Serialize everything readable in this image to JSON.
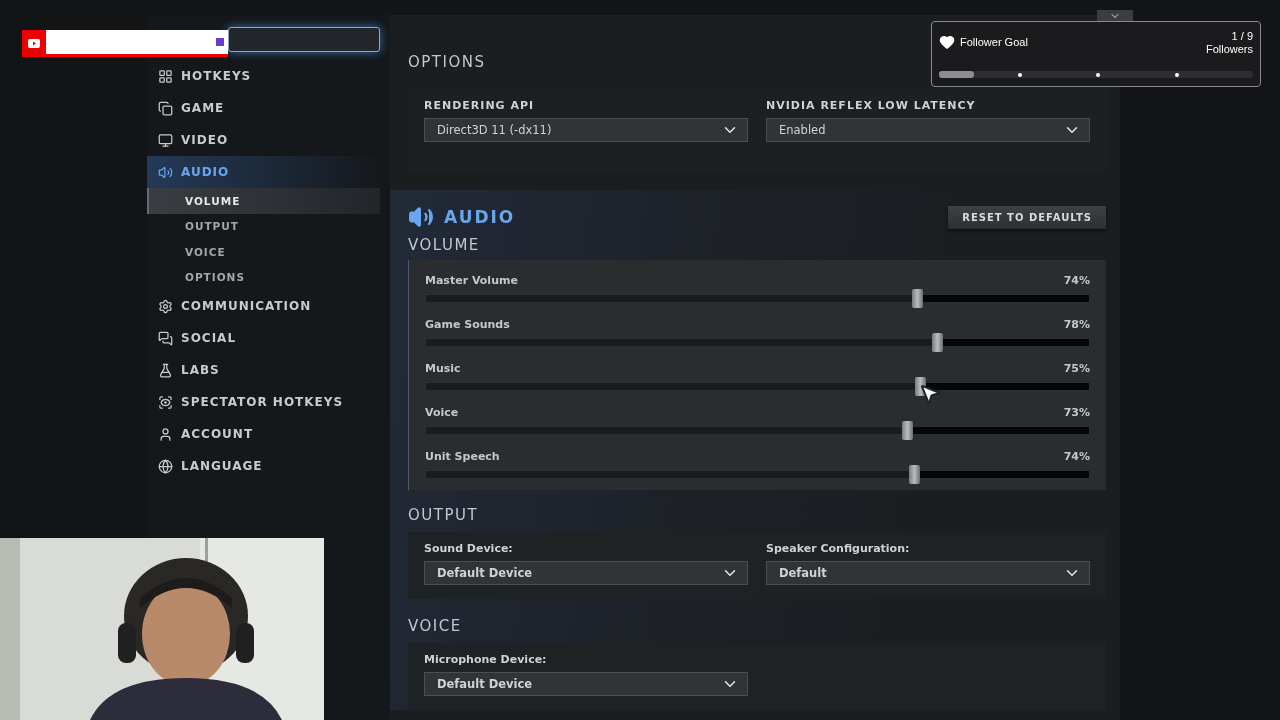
{
  "sidebar": {
    "search": {
      "kind": "field"
    },
    "items": [
      {
        "label": "HOTKEYS",
        "selected": false
      },
      {
        "label": "GAME",
        "selected": false
      },
      {
        "label": "VIDEO",
        "selected": false
      },
      {
        "label": "AUDIO",
        "selected": true,
        "children": [
          {
            "label": "VOLUME",
            "selected": true
          },
          {
            "label": "OUTPUT",
            "selected": false
          },
          {
            "label": "VOICE",
            "selected": false
          },
          {
            "label": "OPTIONS",
            "selected": false
          }
        ]
      },
      {
        "label": "COMMUNICATION",
        "selected": false
      },
      {
        "label": "SOCIAL",
        "selected": false
      },
      {
        "label": "LABS",
        "selected": false
      },
      {
        "label": "SPECTATOR HOTKEYS",
        "selected": false
      },
      {
        "label": "ACCOUNT",
        "selected": false
      },
      {
        "label": "LANGUAGE",
        "selected": false
      }
    ]
  },
  "options": {
    "heading": "OPTIONS",
    "fields": [
      {
        "label": "RENDERING API",
        "value": "Direct3D 11 (-dx11)"
      },
      {
        "label": "NVIDIA REFLEX LOW LATENCY",
        "value": "Enabled"
      }
    ]
  },
  "audio": {
    "title": "AUDIO",
    "reset_button": "RESET TO DEFAULTS",
    "volume": {
      "heading": "VOLUME",
      "sliders": [
        {
          "label": "Master Volume",
          "reading": "74%",
          "level": 0.74
        },
        {
          "label": "Game Sounds",
          "reading": "78%",
          "level": 0.77
        },
        {
          "label": "Music",
          "reading": "75%",
          "level": 0.745
        },
        {
          "label": "Voice",
          "reading": "73%",
          "level": 0.725
        },
        {
          "label": "Unit Speech",
          "reading": "74%",
          "level": 0.735
        }
      ]
    },
    "output": {
      "heading": "OUTPUT",
      "fields": [
        {
          "label": "Sound Device:",
          "value": "Default Device"
        },
        {
          "label": "Speaker Configuration:",
          "value": "Default"
        }
      ]
    },
    "voice": {
      "heading": "VOICE",
      "fields": [
        {
          "label": "Microphone Device:",
          "value": "Default Device"
        }
      ]
    }
  },
  "follower_goal": {
    "title": "Follower Goal",
    "count": "1 / 9",
    "unit": "Followers",
    "level": 0.11
  }
}
